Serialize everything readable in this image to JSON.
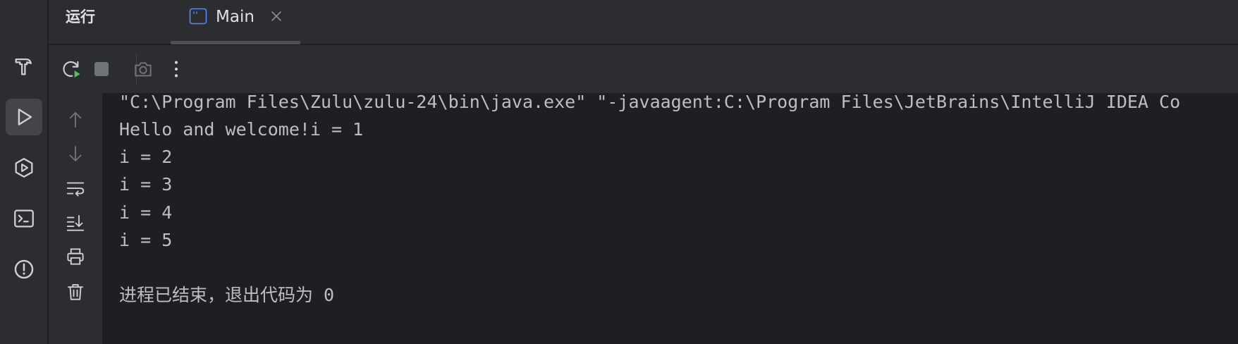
{
  "header": {
    "title": "运行",
    "tab": {
      "label": "Main",
      "icon": "console-window-icon"
    }
  },
  "left_stripe": {
    "items": [
      {
        "name": "build",
        "icon": "hammer-icon"
      },
      {
        "name": "run",
        "icon": "play-icon",
        "active": true
      },
      {
        "name": "services",
        "icon": "hexagon-play-icon"
      },
      {
        "name": "terminal",
        "icon": "terminal-icon"
      },
      {
        "name": "problems",
        "icon": "exclamation-circle-icon"
      }
    ]
  },
  "toolbar": {
    "items": [
      {
        "name": "rerun",
        "icon": "rerun-icon"
      },
      {
        "name": "stop",
        "icon": "stop-icon"
      },
      {
        "name": "screenshot",
        "icon": "camera-icon",
        "disabled": true
      },
      {
        "name": "more",
        "icon": "more-vertical-icon"
      }
    ]
  },
  "gutter": {
    "items": [
      {
        "name": "scroll-up",
        "icon": "arrow-up-icon",
        "disabled": true
      },
      {
        "name": "scroll-down",
        "icon": "arrow-down-icon",
        "disabled": true
      },
      {
        "name": "soft-wrap",
        "icon": "soft-wrap-icon"
      },
      {
        "name": "scroll-to-end",
        "icon": "scroll-to-end-icon"
      },
      {
        "name": "print",
        "icon": "printer-icon"
      },
      {
        "name": "clear",
        "icon": "trash-icon"
      }
    ]
  },
  "console": {
    "lines": [
      "\"C:\\Program Files\\Zulu\\zulu-24\\bin\\java.exe\" \"-javaagent:C:\\Program Files\\JetBrains\\IntelliJ IDEA Co",
      "Hello and welcome!i = 1",
      "i = 2",
      "i = 3",
      "i = 4",
      "i = 5",
      "",
      "进程已结束，退出代码为 0"
    ]
  },
  "colors": {
    "background": "#1e1f22",
    "panel": "#2b2d30",
    "text": "#bcbec4",
    "icon": "#ced0d6",
    "icon_disabled": "#6f737a",
    "run_green": "#5fb865",
    "tab_icon_blue": "#548af7"
  }
}
